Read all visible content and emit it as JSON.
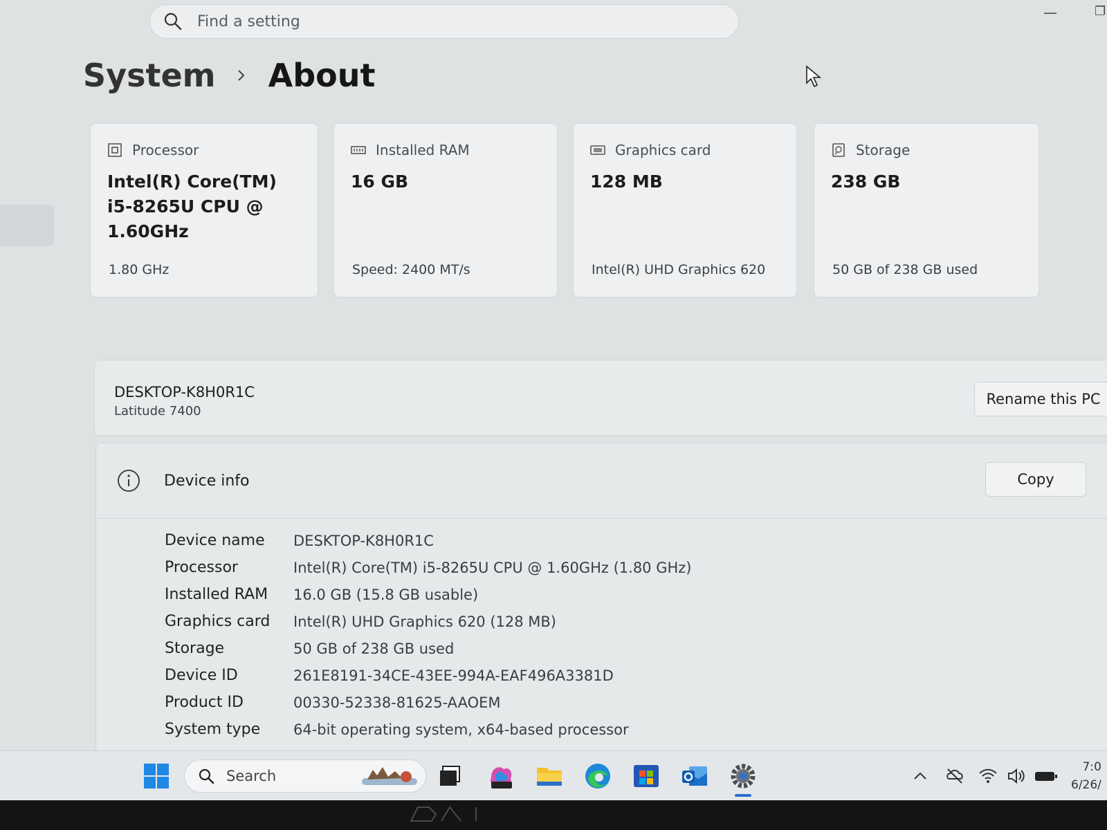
{
  "search": {
    "placeholder": "Find a setting"
  },
  "breadcrumb": {
    "parent": "System",
    "current": "About"
  },
  "cards": [
    {
      "label": "Processor",
      "value": "Intel(R) Core(TM) i5-8265U CPU @ 1.60GHz",
      "sub": "1.80 GHz"
    },
    {
      "label": "Installed RAM",
      "value": "16 GB",
      "sub": "Speed: 2400 MT/s"
    },
    {
      "label": "Graphics card",
      "value": "128 MB",
      "sub": "Intel(R) UHD Graphics 620"
    },
    {
      "label": "Storage",
      "value": "238 GB",
      "sub": "50 GB of 238 GB used"
    }
  ],
  "pc": {
    "name": "DESKTOP-K8H0R1C",
    "model": "Latitude 7400",
    "rename_label": "Rename this PC"
  },
  "device_info": {
    "title": "Device info",
    "copy_label": "Copy",
    "rows": [
      {
        "label": "Device name",
        "value": "DESKTOP-K8H0R1C"
      },
      {
        "label": "Processor",
        "value": "Intel(R) Core(TM) i5-8265U CPU @ 1.60GHz (1.80 GHz)"
      },
      {
        "label": "Installed RAM",
        "value": "16.0 GB (15.8 GB usable)"
      },
      {
        "label": "Graphics card",
        "value": "Intel(R) UHD Graphics 620 (128 MB)"
      },
      {
        "label": "Storage",
        "value": "50 GB of 238 GB used"
      },
      {
        "label": "Device ID",
        "value": "261E8191-34CE-43EE-994A-EAF496A3381D"
      },
      {
        "label": "Product ID",
        "value": "00330-52338-81625-AAOEM"
      },
      {
        "label": "System type",
        "value": "64-bit operating system, x64-based processor"
      }
    ]
  },
  "taskbar": {
    "search_label": "Search",
    "clock_time": "7:0",
    "clock_date": "6/26/"
  },
  "colors": {
    "accent": "#2a6fd1",
    "windows_blue": "#1e88e5"
  },
  "icons": [
    "search-icon",
    "chevron-right-icon",
    "processor-icon",
    "ram-icon",
    "graphics-card-icon",
    "storage-icon",
    "info-icon",
    "windows-start-icon",
    "task-view-icon",
    "m365-icon",
    "file-explorer-icon",
    "edge-icon",
    "store-icon",
    "outlook-icon",
    "settings-icon",
    "chevron-up-icon",
    "sync-off-icon",
    "wifi-icon",
    "volume-icon",
    "battery-icon"
  ]
}
